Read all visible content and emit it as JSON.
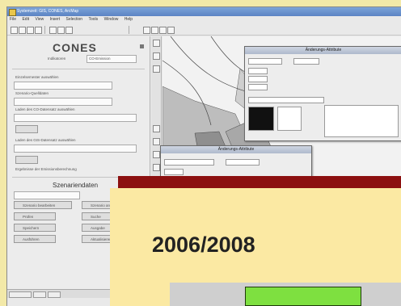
{
  "app": {
    "title": "Systemzeit: GIS, CONES, ArcMap",
    "menu": [
      "File",
      "Edit",
      "View",
      "Insert",
      "Selection",
      "Tools",
      "Window",
      "Help"
    ],
    "logo": "CONES"
  },
  "left_panel": {
    "select_label": "Indikatoren",
    "select_value": "CO-Emission",
    "field_labels": [
      "Einzelsemester auswählen",
      "Szenario-Quelldaten",
      "Laden des CO-Datensatz auswählen",
      "Laden des GIS-Datensatz auswählen",
      "Ergebnisse der Emissionsberechnung"
    ],
    "section_title": "Szenariendaten",
    "buttons": [
      "Szenario bearbeiten",
      "Szenario anlegen",
      "Prüfen",
      "Suche",
      "Speichern",
      "Ausgabe",
      "Ausführen",
      "Aktualisieren"
    ]
  },
  "dialogs": [
    {
      "title": "Änderungs-Attribute"
    },
    {
      "title": "Änderungs-Attribute"
    }
  ],
  "overlay": {
    "year_label": "2006/2008",
    "band_color": "#8c1010",
    "panel_color": "#fbe9a3",
    "button_color": "#7ee040"
  }
}
